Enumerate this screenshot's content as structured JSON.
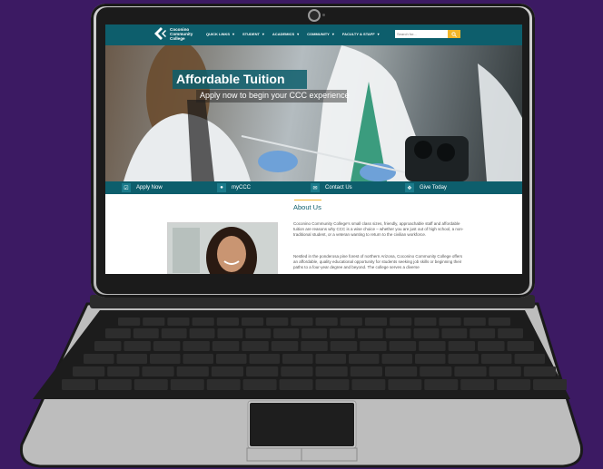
{
  "site": {
    "logo_line1": "Coconino",
    "logo_line2": "Community",
    "logo_line3": "College",
    "nav": [
      "QUICK LINKS",
      "STUDENT",
      "ACADEMICS",
      "COMMUNITY",
      "FACULTY & STAFF"
    ],
    "search_placeholder": "Search for..."
  },
  "hero": {
    "title": "Affordable Tuition",
    "subtitle": "Apply now to begin your CCC experience"
  },
  "quicklinks": [
    {
      "label": "Apply Now",
      "icon": "checkbox-icon"
    },
    {
      "label": "myCCC",
      "icon": "user-icon"
    },
    {
      "label": "Contact Us",
      "icon": "envelope-icon"
    },
    {
      "label": "Give Today",
      "icon": "gift-icon"
    }
  ],
  "about": {
    "title": "About Us",
    "para1": "Coconino Community College's small class sizes, friendly, approachable staff and affordable tuition are reasons why CCC is a wise choice – whether you are just out of high school, a non-traditional student, or a veteran wanting to return to the civilian workforce.",
    "para2": "Nestled in the ponderosa pine forest of northern Arizona, Coconino Community College offers an affordable, quality educational opportunity for students seeking job skills or beginning their paths to a four-year degree and beyond. The college serves a diverse"
  },
  "colors": {
    "background": "#3c1a63",
    "header": "#0d5e6c",
    "accent": "#f2b629"
  }
}
